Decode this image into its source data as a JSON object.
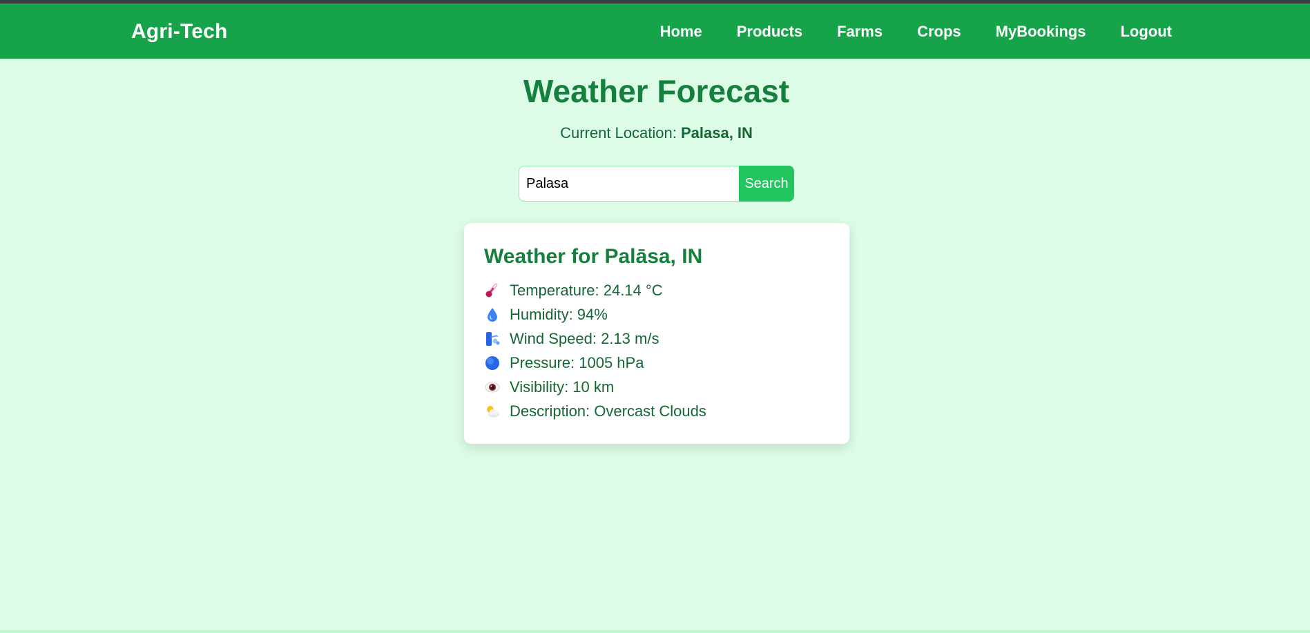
{
  "navbar": {
    "brand": "Agri-Tech",
    "links": [
      "Home",
      "Products",
      "Farms",
      "Crops",
      "MyBookings",
      "Logout"
    ]
  },
  "main": {
    "title": "Weather Forecast",
    "location_label": "Current Location:",
    "location_value": "Palasa, IN"
  },
  "search": {
    "value": "Palasa",
    "button_label": "Search"
  },
  "weather": {
    "title": "Weather for Palāsa, IN",
    "rows": [
      {
        "icon": "thermometer-icon",
        "text": "Temperature: 24.14 °C"
      },
      {
        "icon": "droplet-icon",
        "text": "Humidity: 94%"
      },
      {
        "icon": "wind-icon",
        "text": "Wind Speed: 2.13 m/s"
      },
      {
        "icon": "globe-icon",
        "text": "Pressure: 1005 hPa"
      },
      {
        "icon": "eye-icon",
        "text": "Visibility: 10 km"
      },
      {
        "icon": "cloud-icon",
        "text": "Description: Overcast Clouds"
      }
    ]
  },
  "colors": {
    "navbar": "#16a34a",
    "background": "#dcfce7",
    "heading": "#15803d",
    "button": "#22c55e"
  }
}
